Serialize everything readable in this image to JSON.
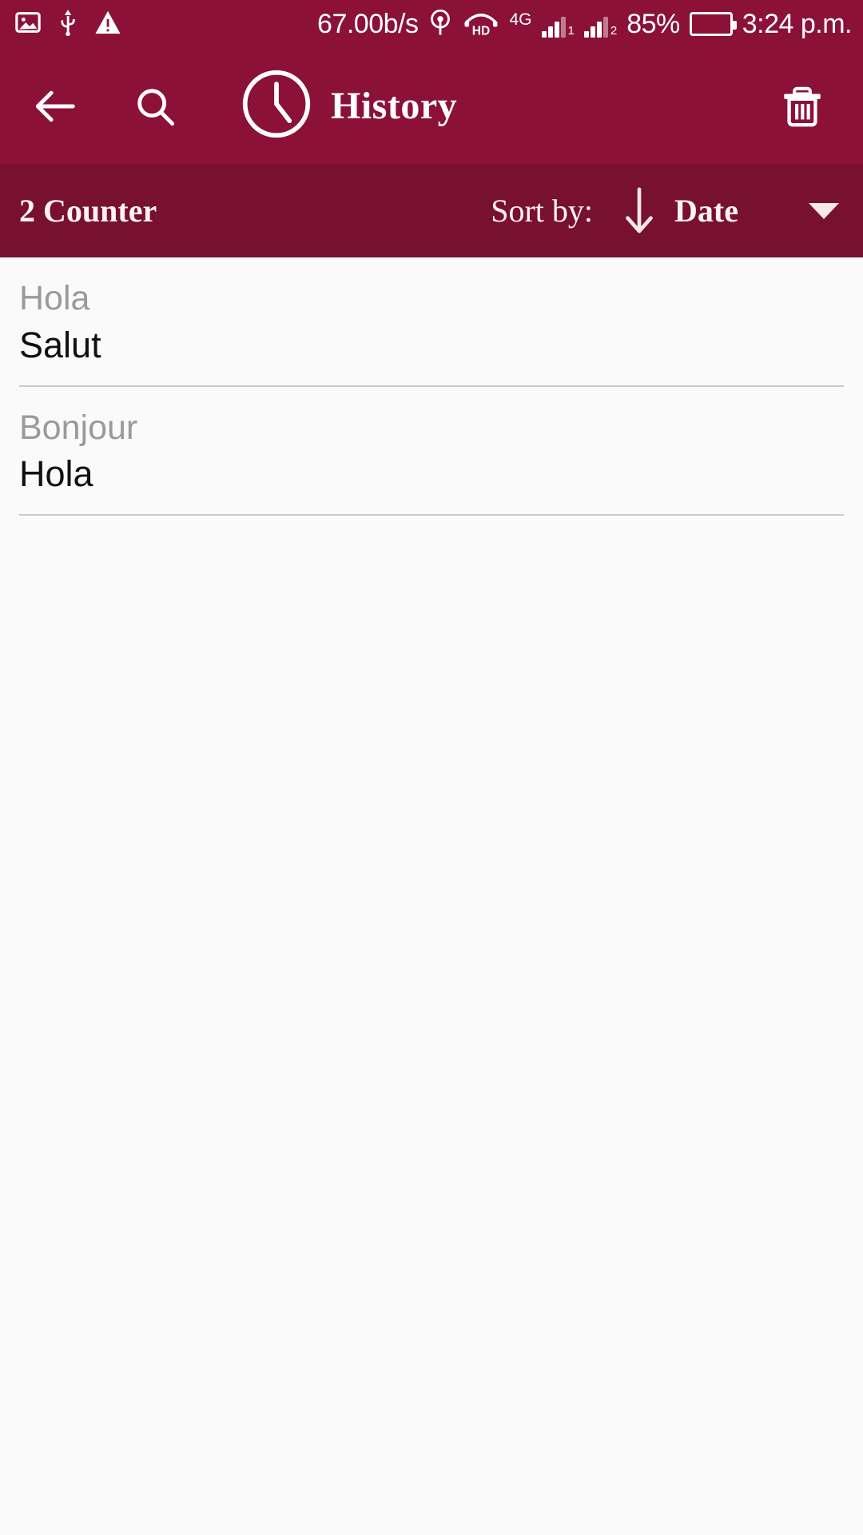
{
  "status_bar": {
    "left_icons": [
      "image-icon",
      "usb-icon",
      "warning-icon"
    ],
    "network_speed": "67.00b/s",
    "hotspot_icon": "hotspot-icon",
    "hd_voice_label": "HD",
    "network_type": "4G",
    "sim1_label": "1",
    "sim2_label": "2",
    "battery_percent": "85%",
    "time": "3:24 p.m."
  },
  "app_bar": {
    "back_icon": "back-arrow-icon",
    "search_icon": "search-icon",
    "clock_icon": "clock-icon",
    "title": "History",
    "delete_icon": "trash-icon"
  },
  "sort_bar": {
    "counter": "2 Counter",
    "sort_by_label": "Sort by:",
    "sort_direction_icon": "arrow-down-icon",
    "sort_value": "Date",
    "dropdown_icon": "caret-down-icon"
  },
  "history": {
    "items": [
      {
        "source": "Hola",
        "translation": "Salut"
      },
      {
        "source": "Bonjour",
        "translation": "Hola"
      }
    ]
  },
  "colors": {
    "app_bar": "#8b1138",
    "sort_bar": "#78102f",
    "body_bg": "#fafafa",
    "battery_green": "#2ee000",
    "source_text": "#9a9a9a",
    "translation_text": "#111111"
  }
}
